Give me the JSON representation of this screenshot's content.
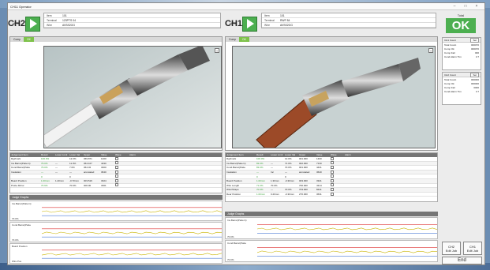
{
  "window": {
    "title": "CH11 Operator",
    "min": "–",
    "max": "□",
    "close": "×"
  },
  "ch2": {
    "label": "CH2",
    "nps": "NPS",
    "info": [
      {
        "k": "Item",
        "v": "101"
      },
      {
        "k": "Terminal",
        "v": "123PTS 04"
      },
      {
        "k": "Wire",
        "v": "AVSS2GG"
      }
    ],
    "tabs": [
      "Comp",
      "OK"
    ],
    "table": {
      "headers": [
        "Judgement Item",
        "Result",
        "Lower Limit",
        "Lower Val",
        "Upper",
        "Value",
        "Wave",
        "Alarm"
      ],
      "rows": [
        [
          "Rgt/mark",
          "100.0%",
          "",
          "12.0%",
          "069.871",
          "1400"
        ],
        [
          "Ins.Barrel(Pattern)",
          "79.0%",
          "—",
          "11.0%",
          "064.107",
          "4330"
        ],
        [
          "Cond.Barrel(Patte",
          "79.0%",
          "—",
          "7.0%",
          "064.32",
          "3300"
        ],
        [
          "Insulation",
          "—",
          "—",
          "—",
          "annotated",
          "3640"
        ],
        [
          "",
          "0",
          "",
          "0",
          "",
          ""
        ],
        [
          "Board Position",
          "1.00mm",
          "1.20mm",
          "-0.70mm",
          "003.516",
          "3324"
        ],
        [
          "Probe.Mirror",
          "70.9%",
          "",
          "70.9%",
          "000.00",
          "3361"
        ]
      ]
    },
    "graphs_title": "Judge Graphs",
    "graphs": [
      {
        "label": "Ins.Barrel(Pattern)",
        "sub": "70.0%"
      },
      {
        "label": "Cond.Barrel(Patte",
        "sub": "70.0%"
      },
      {
        "label": "Board Position",
        "sub": "Wire Pos"
      }
    ]
  },
  "ch1": {
    "label": "CH1",
    "nps": "NPS",
    "info": [
      {
        "k": "Item",
        "v": "101"
      },
      {
        "k": "Terminal",
        "v": "RWF 84"
      },
      {
        "k": "Wire",
        "v": "AVSS2GG"
      }
    ],
    "tabs": [
      "Comp",
      "OK"
    ],
    "table": {
      "headers": [
        "Judgement Item",
        "Result",
        "Lower Limit",
        "Lower Val",
        "Upper",
        "Value",
        "Wave",
        "Alarm"
      ],
      "rows": [
        [
          "Rgt/mark",
          "100.0%",
          "",
          "12.0%",
          "001.000",
          "1400"
        ],
        [
          "Ins.Barrel(Pattern)",
          "83.0%",
          "—",
          "71.0%",
          "002.000",
          "7130"
        ],
        [
          "Cond.Barrel(Patte",
          "83.0%",
          "—",
          "70.0%",
          "001.000",
          "4421"
        ],
        [
          "Insulation",
          "—",
          "Inc",
          "—",
          "annotated",
          "3640"
        ],
        [
          "",
          "0",
          "",
          "0",
          "",
          ""
        ],
        [
          "Board Position",
          "1.00mm",
          "1.30mm",
          "-0.30mm",
          "003.000",
          "3321"
        ],
        [
          "Wire Length",
          "71.0%",
          "70.0%",
          "",
          "700.000",
          "4314"
        ],
        [
          "Wire/Shape",
          "70.0%",
          "—",
          "70.0%",
          "703.000",
          "8441"
        ],
        [
          "Rear Position",
          "1.00mm",
          "0.20mm",
          "-0.30mm",
          "270.000",
          "3631"
        ]
      ]
    },
    "graphs_title": "Judge Graphs",
    "graphs": [
      {
        "label": "Ins.Barrel(Pattern)",
        "sub": "70.0%"
      },
      {
        "label": "Cond.Barrel(Patte",
        "sub": "70.0%"
      }
    ]
  },
  "total": {
    "label": "Total",
    "status": "OK",
    "color": "#4caf50"
  },
  "stats_ch1": {
    "title": "CH1 Count",
    "btn": "Set",
    "rows": [
      [
        "Total Count",
        "000070"
      ],
      [
        "Comp Ok",
        "000070"
      ],
      [
        "Comp Fail",
        "000"
      ],
      [
        "Cond.Alarm Ttm",
        "3.7"
      ]
    ]
  },
  "stats_ch2": {
    "title": "CH2 Count",
    "btn": "Set",
    "rows": [
      [
        "Total Count",
        "000000"
      ],
      [
        "Comp Ok",
        "000000"
      ],
      [
        "Comp Fail",
        "0000"
      ],
      [
        "Cond.Alarm Ttm",
        "3.7"
      ]
    ]
  },
  "buttons": {
    "ch2_edit": [
      "CH2",
      "Edit Job"
    ],
    "ch1_edit": [
      "CH1",
      "Edit Job"
    ],
    "end": "End"
  }
}
